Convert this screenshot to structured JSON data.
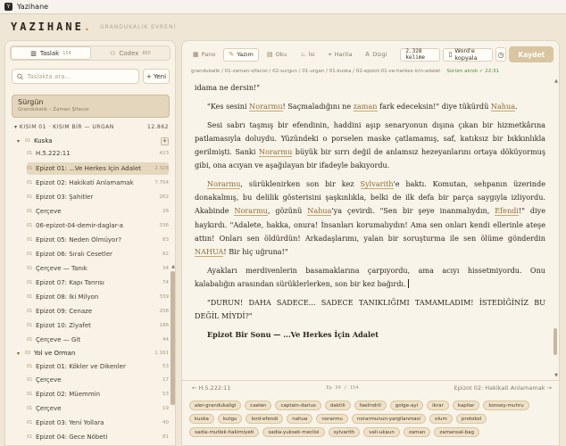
{
  "window": {
    "title": "Yazihane",
    "icon": "Y"
  },
  "app": {
    "logo": "YAZIHANE",
    "logo_dot": ".",
    "tagline": "GRANDUKALIK EVRENİ"
  },
  "sidebar": {
    "tabs": [
      {
        "label": "Taslak",
        "count": "154",
        "icon": "book-icon"
      },
      {
        "label": "Codex",
        "count": "865",
        "icon": "people-icon"
      }
    ],
    "search_placeholder": "Taslakta ara...",
    "new_button": "+ Yeni",
    "book": {
      "title": "Sürgün",
      "subtitle": "Grandukalık – Zaman Şifacısı"
    },
    "part": {
      "label": "KISIM 01 · KISIM BİR — URGAN",
      "count": "12.862"
    },
    "rows": [
      {
        "num": "01",
        "label": "Kuska",
        "count": "",
        "kind": "chapter"
      },
      {
        "num": "01",
        "label": "H.5.222:11",
        "count": "423",
        "kind": "child"
      },
      {
        "num": "01",
        "label": "Epizot 01: ...Ve Herkes İçin Adalet",
        "count": "2.328",
        "kind": "child"
      },
      {
        "num": "01",
        "label": "Epizot 02: Hakikati Anlamamak",
        "count": "7.754",
        "kind": "child"
      },
      {
        "num": "01",
        "label": "Epizot 03: Şahitler",
        "count": "262",
        "kind": "child"
      },
      {
        "num": "01",
        "label": "Çerçeve",
        "count": "26",
        "kind": "child"
      },
      {
        "num": "01",
        "label": "06-epizot-04-demir-daglar-a",
        "count": "336",
        "kind": "child"
      },
      {
        "num": "01",
        "label": "Epizot 05: Neden Ölmüyor?",
        "count": "83",
        "kind": "child"
      },
      {
        "num": "01",
        "label": "Epizot 06: Sıralı Cesetler",
        "count": "82",
        "kind": "child"
      },
      {
        "num": "01",
        "label": "Çerçeve — Tanık",
        "count": "34",
        "kind": "child"
      },
      {
        "num": "01",
        "label": "Epizot 07: Kapı Tanrısı",
        "count": "74",
        "kind": "child"
      },
      {
        "num": "01",
        "label": "Epizot 08: İki Milyon",
        "count": "339",
        "kind": "child"
      },
      {
        "num": "01",
        "label": "Epizot 09: Cenaze",
        "count": "208",
        "kind": "child"
      },
      {
        "num": "01",
        "label": "Epizot 10: Ziyafet",
        "count": "186",
        "kind": "child"
      },
      {
        "num": "01",
        "label": "Çerçeve — Git",
        "count": "44",
        "kind": "child"
      },
      {
        "num": "02",
        "label": "Yol ve Orman",
        "count": "1.161",
        "kind": "chapter"
      },
      {
        "num": "01",
        "label": "Epizot 01: Kökler ve Dikenler",
        "count": "53",
        "kind": "child"
      },
      {
        "num": "01",
        "label": "Çerçeve",
        "count": "17",
        "kind": "child"
      },
      {
        "num": "01",
        "label": "Epizot 02: Müemmin",
        "count": "53",
        "kind": "child"
      },
      {
        "num": "01",
        "label": "Çerçeve",
        "count": "19",
        "kind": "child"
      },
      {
        "num": "01",
        "label": "Epizot 03: Yeni Yollara",
        "count": "40",
        "kind": "child"
      },
      {
        "num": "01",
        "label": "Epizot 04: Gece Nöbeti",
        "count": "81",
        "kind": "child"
      }
    ]
  },
  "toolbar": {
    "tabs": [
      {
        "label": "Pano",
        "icon": "grid-icon"
      },
      {
        "label": "Yazım",
        "icon": "pen-icon"
      },
      {
        "label": "Oku",
        "icon": "book-icon"
      },
      {
        "label": "İsi",
        "icon": "flame-icon"
      },
      {
        "label": "Harita",
        "icon": "map-icon"
      },
      {
        "label": "Dizgi",
        "icon": "text-icon"
      }
    ],
    "word_count": "2.328 kelime",
    "copy_label": "Word'e kopyala",
    "save_label": "Kaydet"
  },
  "breadcrumb": {
    "path": "grandukalik / 01-zaman-sifacisi / 02-surgun / 01-urgan / 01-kuska / 02-epizot-01-ve-herkes-icin-adalet",
    "saved": "Sürüm alındı ✓ 22:31"
  },
  "text": {
    "p0": "idama ne dersin!\"",
    "p1": {
      "a": "\"Kes sesini ",
      "n1": "Norarmu",
      "b": "! Saçmaladığını ne ",
      "n2": "zaman",
      "c": " fark edeceksin!\" diye tükürdü ",
      "n3": "Nahua",
      "d": "."
    },
    "p2": {
      "a": "Sesi sabrı taşmış bir efendinin, haddini aşıp senaryonun dışına çıkan bir hizmetkârına patlamasıyla doluydu. Yüzündeki o porselen maske çatlamamış, saf, katıksız bir bıkkınlıkla gerilmişti. Sanki ",
      "n1": "Norarmu",
      "b": " büyük bir sırrı değil de anlamsız hezeyanlarını ortaya döküyormuş gibi, ona acıyan ve aşağılayan bir ifadeyle bakıyordu."
    },
    "p3": {
      "n0": "Norarmu",
      "a": ", sürüklenirken son bir kez ",
      "n1": "Sylvarith",
      "b": "'e baktı. Komutan, sehpanın üzerinde donakalmış, bu delilik gösterisini şaşkınlıkla, belki de ilk defa bir parça saygıyla izliyordu. Akabinde ",
      "n2": "Norarmu",
      "c": ", gözünü ",
      "n3": "Nahua",
      "d": "'ya çevirdi. \"Sen bir şeye inanmalıydın, ",
      "n4": "Efendi",
      "e": "!\" diye haykırdı. \"Adalete, hakka, onura! İnsanları korumalıydın! Ama sen onları kendi ellerinle ateşe attın! Onları sen öldürdün! Arkadaşlarımı, yalan bir soruşturma ile sen ölüme gönderdin ",
      "n5": "NAHUA",
      "f": "! Bir hiç uğruna!\""
    },
    "p4": "Ayakları merdivenlerin basamaklarına çarpıyordu, ama acıyı hissetmiyordu. Onu kalabalığın arasından sürüklerlerken, son bir kez bağırdı.",
    "p5": "\"DURUN! DAHA SADECE... SADECE TANIKLIĞIMI TAMAMLADIM! İSTEDİĞİNİZ BU DEĞİL MİYDİ?\"",
    "end": "Epizot Bir Sonu — ...Ve Herkes İçin Adalet"
  },
  "footer": {
    "prev": "← H.5.222:11",
    "page": "Ep 34 / 154",
    "next": "Epizot 02: Hakikati Anlamamak →"
  },
  "tags": [
    "aler-grandukaligi",
    "caelen",
    "captain-darius",
    "daktili",
    "faelindril",
    "golge-ayi",
    "ikrar",
    "kapilar",
    "konsey-muhru",
    "kuska",
    "kutgu",
    "lord-efendi",
    "nahua",
    "norarmu",
    "norarmunun-yargilanmasi",
    "olum",
    "protokol",
    "sadia-mutlek-hakimiyeti",
    "sadia-yuksek-meclisi",
    "sylvarith",
    "vali-ukaun",
    "zaman",
    "zamansal-bag"
  ],
  "colors": {
    "accent": "#b8892a",
    "save": "#d9c5a0",
    "saved": "#4f8a3a"
  }
}
